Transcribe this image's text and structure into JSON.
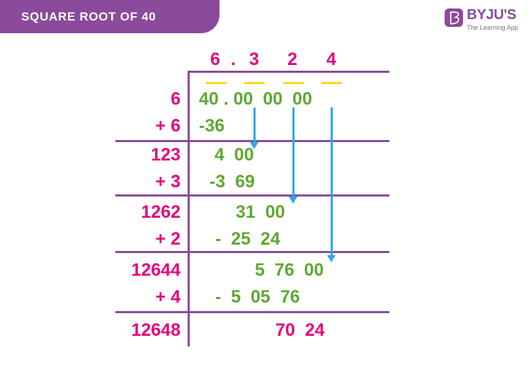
{
  "header": {
    "title": "SQUARE ROOT OF 40",
    "bar_color": "#8B4A9C"
  },
  "logo": {
    "mark_icon": "byjus-b-icon",
    "word": "BYJU'S",
    "tagline": "The Learning App",
    "color": "#8B4A9C"
  },
  "colors": {
    "pink": "#E6007E",
    "green": "#5EA832",
    "purple": "#8B4A9C",
    "yellow": "#FFD814",
    "blue_arrow": "#29ABE2"
  },
  "worksheet": {
    "quotient": {
      "digits": [
        "6",
        ".",
        "3",
        "2",
        "4"
      ]
    },
    "dividend": {
      "groups": [
        "40",
        ".",
        "00",
        "00",
        "00"
      ],
      "overbar_count": 4
    },
    "steps": [
      {
        "divisor": "6",
        "addend": "+ 6",
        "bring_down": "",
        "subtrahend": "-36"
      },
      {
        "divisor": "123",
        "addend": "+ 3",
        "bring_down": "4  00",
        "subtrahend": "-3  69"
      },
      {
        "divisor": "1262",
        "addend": "+ 2",
        "bring_down": "31  00",
        "subtrahend": "-  25  24"
      },
      {
        "divisor": "12644",
        "addend": "+ 4",
        "bring_down": "5  76  00",
        "subtrahend": "-  5  05  76"
      }
    ],
    "final": {
      "divisor": "12648",
      "remainder": "70  24"
    },
    "rows": {
      "row1_dividend": "40 . 00  00  00",
      "row1_sub": "-36",
      "row2_down": "4  00",
      "row2_sub": "-3  69",
      "row3_down": "31  00",
      "row3_sub": "-  25  24",
      "row4_down": "5  76  00",
      "row4_sub": "-  5  05  76"
    }
  }
}
